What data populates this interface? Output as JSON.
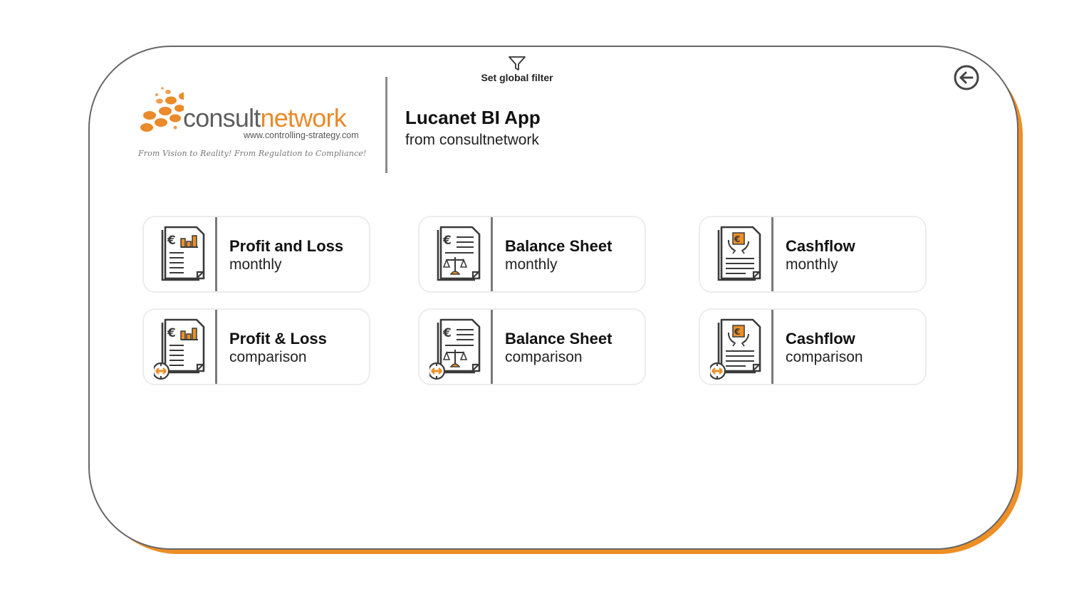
{
  "header": {
    "logo": {
      "word_part1": "consult",
      "word_part2": "network",
      "url": "www.controlling-strategy.com",
      "tagline": "From Vision to Reality! From Regulation to Compliance!"
    },
    "title": "Lucanet BI App",
    "subtitle": "from consultnetwork",
    "global_filter_label": "Set global filter",
    "back_icon": "arrow-left-circle-icon",
    "filter_icon": "funnel-icon"
  },
  "colors": {
    "accent": "#ed8f25",
    "frame_border": "#666666",
    "text": "#111111"
  },
  "tiles": [
    {
      "title": "Profit and Loss",
      "subtitle": "monthly",
      "icon": "pnl-document-icon"
    },
    {
      "title": "Balance Sheet",
      "subtitle": "monthly",
      "icon": "balance-sheet-document-icon"
    },
    {
      "title": "Cashflow",
      "subtitle": "monthly",
      "icon": "cashflow-document-icon"
    },
    {
      "title": "Profit & Loss",
      "subtitle": "comparison",
      "icon": "pnl-comparison-icon"
    },
    {
      "title": "Balance Sheet",
      "subtitle": "comparison",
      "icon": "balance-sheet-comparison-icon"
    },
    {
      "title": "Cashflow",
      "subtitle": "comparison",
      "icon": "cashflow-comparison-icon"
    }
  ]
}
